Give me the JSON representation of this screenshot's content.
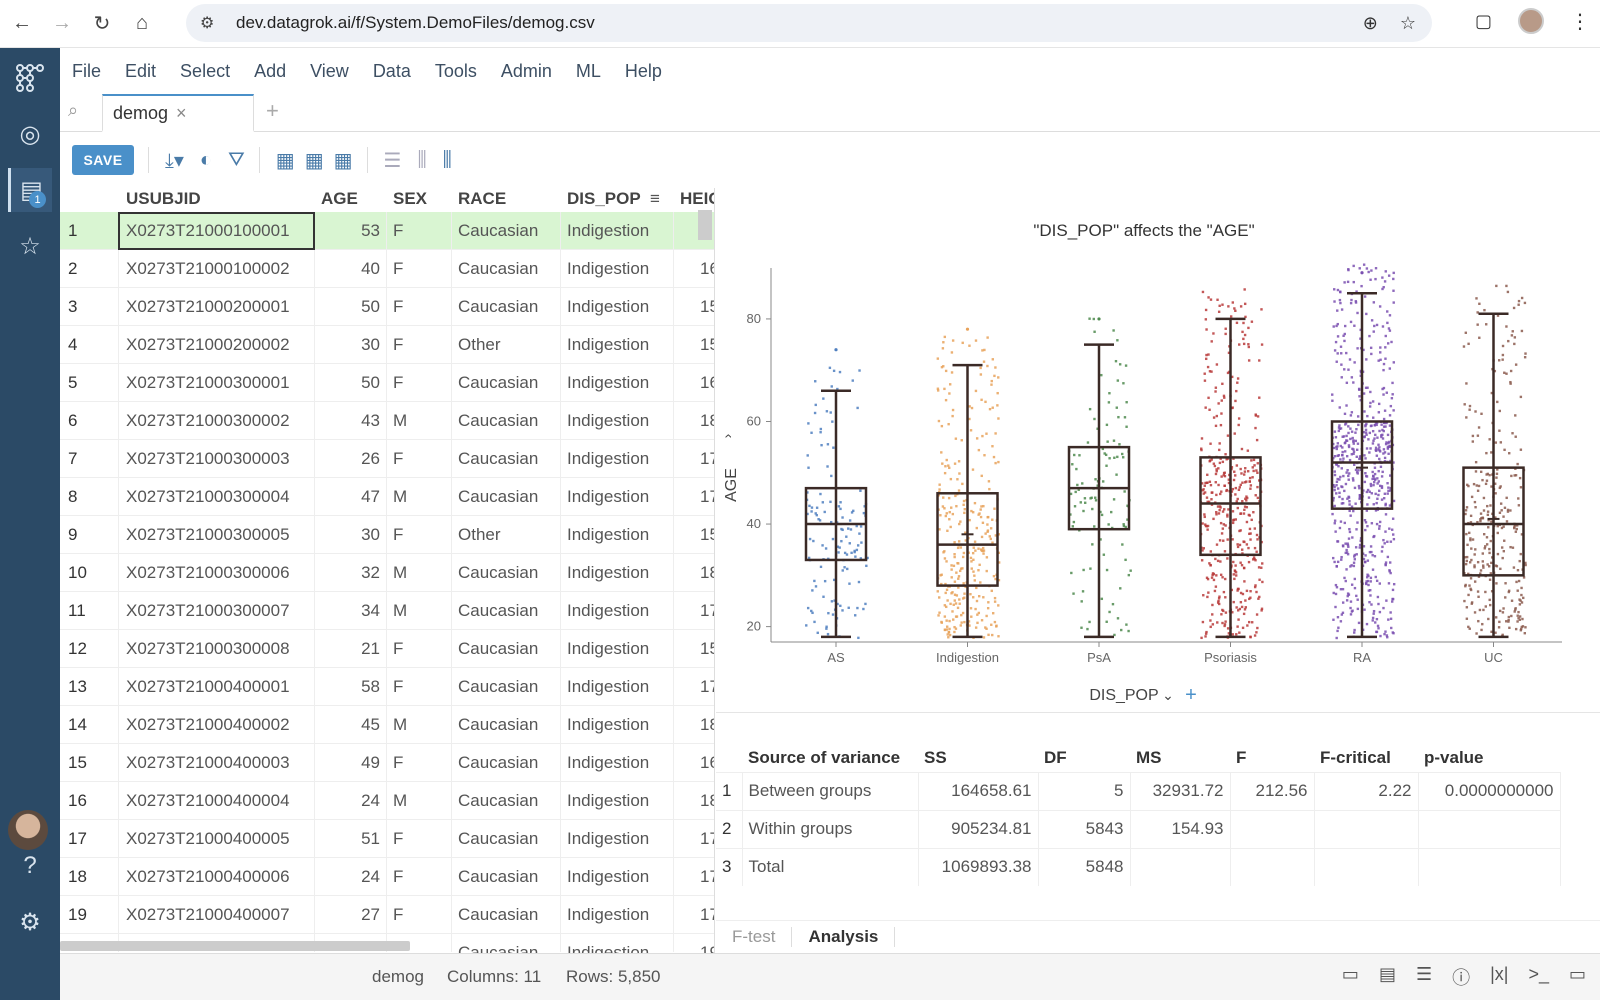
{
  "browser": {
    "url": "dev.datagrok.ai/f/System.DemoFiles/demog.csv"
  },
  "menu": [
    "File",
    "Edit",
    "Select",
    "Add",
    "View",
    "Data",
    "Tools",
    "Admin",
    "ML",
    "Help"
  ],
  "tab": {
    "label": "demog",
    "close": "×",
    "add": "+"
  },
  "toolbar": {
    "save_label": "SAVE"
  },
  "sidebar": {
    "badge": "1"
  },
  "grid": {
    "headers": {
      "id": "USUBJID",
      "age": "AGE",
      "sex": "SEX",
      "race": "RACE",
      "dis": "DIS_POP",
      "hei": "HEIG"
    },
    "rows": [
      {
        "n": "1",
        "id": "X0273T21000100001",
        "age": "53",
        "sex": "F",
        "race": "Caucasian",
        "dis": "Indigestion",
        "hei": ""
      },
      {
        "n": "2",
        "id": "X0273T21000100002",
        "age": "40",
        "sex": "F",
        "race": "Caucasian",
        "dis": "Indigestion",
        "hei": "16"
      },
      {
        "n": "3",
        "id": "X0273T21000200001",
        "age": "50",
        "sex": "F",
        "race": "Caucasian",
        "dis": "Indigestion",
        "hei": "15"
      },
      {
        "n": "4",
        "id": "X0273T21000200002",
        "age": "30",
        "sex": "F",
        "race": "Other",
        "dis": "Indigestion",
        "hei": "15"
      },
      {
        "n": "5",
        "id": "X0273T21000300001",
        "age": "50",
        "sex": "F",
        "race": "Caucasian",
        "dis": "Indigestion",
        "hei": "16"
      },
      {
        "n": "6",
        "id": "X0273T21000300002",
        "age": "43",
        "sex": "M",
        "race": "Caucasian",
        "dis": "Indigestion",
        "hei": "18"
      },
      {
        "n": "7",
        "id": "X0273T21000300003",
        "age": "26",
        "sex": "F",
        "race": "Caucasian",
        "dis": "Indigestion",
        "hei": "17"
      },
      {
        "n": "8",
        "id": "X0273T21000300004",
        "age": "47",
        "sex": "M",
        "race": "Caucasian",
        "dis": "Indigestion",
        "hei": "17"
      },
      {
        "n": "9",
        "id": "X0273T21000300005",
        "age": "30",
        "sex": "F",
        "race": "Other",
        "dis": "Indigestion",
        "hei": "15"
      },
      {
        "n": "10",
        "id": "X0273T21000300006",
        "age": "32",
        "sex": "M",
        "race": "Caucasian",
        "dis": "Indigestion",
        "hei": "18"
      },
      {
        "n": "11",
        "id": "X0273T21000300007",
        "age": "34",
        "sex": "M",
        "race": "Caucasian",
        "dis": "Indigestion",
        "hei": "17"
      },
      {
        "n": "12",
        "id": "X0273T21000300008",
        "age": "21",
        "sex": "F",
        "race": "Caucasian",
        "dis": "Indigestion",
        "hei": "15"
      },
      {
        "n": "13",
        "id": "X0273T21000400001",
        "age": "58",
        "sex": "F",
        "race": "Caucasian",
        "dis": "Indigestion",
        "hei": "17"
      },
      {
        "n": "14",
        "id": "X0273T21000400002",
        "age": "45",
        "sex": "M",
        "race": "Caucasian",
        "dis": "Indigestion",
        "hei": "18"
      },
      {
        "n": "15",
        "id": "X0273T21000400003",
        "age": "49",
        "sex": "F",
        "race": "Caucasian",
        "dis": "Indigestion",
        "hei": "16"
      },
      {
        "n": "16",
        "id": "X0273T21000400004",
        "age": "24",
        "sex": "M",
        "race": "Caucasian",
        "dis": "Indigestion",
        "hei": "18"
      },
      {
        "n": "17",
        "id": "X0273T21000400005",
        "age": "51",
        "sex": "F",
        "race": "Caucasian",
        "dis": "Indigestion",
        "hei": "17"
      },
      {
        "n": "18",
        "id": "X0273T21000400006",
        "age": "24",
        "sex": "F",
        "race": "Caucasian",
        "dis": "Indigestion",
        "hei": "17"
      },
      {
        "n": "19",
        "id": "X0273T21000400007",
        "age": "27",
        "sex": "F",
        "race": "Caucasian",
        "dis": "Indigestion",
        "hei": "17"
      },
      {
        "n": "",
        "id": "",
        "age": "",
        "sex": "",
        "race": "Caucasian",
        "dis": "Indigestion",
        "hei": "19"
      }
    ]
  },
  "chart_data": {
    "type": "box",
    "title": "\"DIS_POP\" affects the \"AGE\"",
    "ylabel": "AGE",
    "xlabel": "DIS_POP",
    "ylim": [
      17,
      95
    ],
    "yticks": [
      20,
      40,
      60,
      80
    ],
    "categories": [
      "AS",
      "Indigestion",
      "PsA",
      "Psoriasis",
      "RA",
      "UC"
    ],
    "colors": [
      "#4f7fbf",
      "#e8a25a",
      "#4e8a4e",
      "#b83a3a",
      "#7a4fb0",
      "#8b5a4e"
    ],
    "boxes": [
      {
        "min": 18,
        "q1": 33,
        "median": 40,
        "q3": 47,
        "max": 66,
        "mean": 40,
        "outliers": [
          74
        ]
      },
      {
        "min": 18,
        "q1": 28,
        "median": 36,
        "q3": 46,
        "max": 71,
        "mean": 38,
        "outliers": [
          78
        ]
      },
      {
        "min": 18,
        "q1": 39,
        "median": 47,
        "q3": 55,
        "max": 75,
        "mean": 47,
        "outliers": [
          80
        ]
      },
      {
        "min": 18,
        "q1": 34,
        "median": 44,
        "q3": 53,
        "max": 80,
        "mean": 44,
        "outliers": []
      },
      {
        "min": 18,
        "q1": 43,
        "median": 52,
        "q3": 60,
        "max": 85,
        "mean": 51,
        "outliers": [
          89
        ]
      },
      {
        "min": 18,
        "q1": 30,
        "median": 40,
        "q3": 51,
        "max": 81,
        "mean": 41,
        "outliers": []
      }
    ]
  },
  "anova": {
    "headers": [
      "Source of variance",
      "SS",
      "DF",
      "MS",
      "F",
      "F-critical",
      "p-value"
    ],
    "rows": [
      {
        "n": "1",
        "source": "Between groups",
        "ss": "164658.61",
        "df": "5",
        "ms": "32931.72",
        "f": "212.56",
        "fcrit": "2.22",
        "p": "0.0000000000"
      },
      {
        "n": "2",
        "source": "Within groups",
        "ss": "905234.81",
        "df": "5843",
        "ms": "154.93",
        "f": "",
        "fcrit": "",
        "p": ""
      },
      {
        "n": "3",
        "source": "Total",
        "ss": "1069893.38",
        "df": "5848",
        "ms": "",
        "f": "",
        "fcrit": "",
        "p": ""
      }
    ]
  },
  "bottom_tabs": [
    "F-test",
    "Analysis"
  ],
  "status": {
    "table": "demog",
    "columns": "Columns: 11",
    "rows": "Rows: 5,850"
  }
}
